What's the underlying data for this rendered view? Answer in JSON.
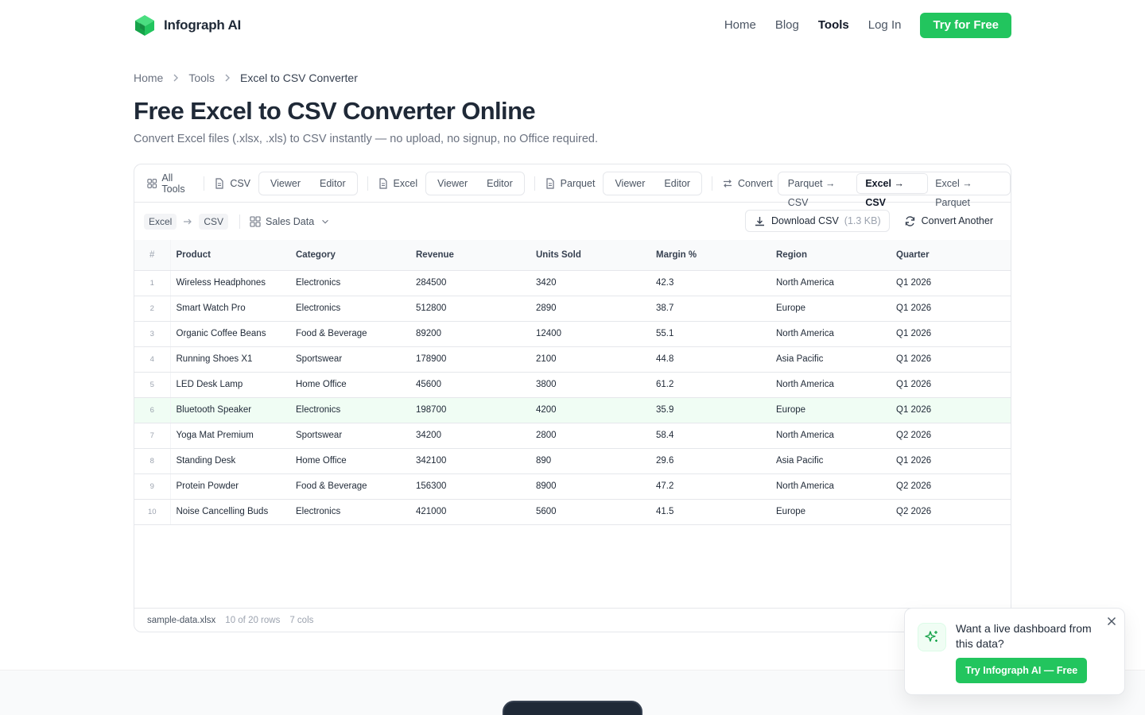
{
  "brand": {
    "name": "Infograph AI",
    "accent": "#22c55e"
  },
  "nav": {
    "links": [
      "Home",
      "Blog",
      "Tools",
      "Log In"
    ],
    "active": "Tools",
    "cta": "Try for Free"
  },
  "breadcrumb": [
    "Home",
    "Tools",
    "Excel to CSV Converter"
  ],
  "page": {
    "title": "Free Excel to CSV Converter Online",
    "subtitle": "Convert Excel files (.xlsx, .xls) to CSV instantly — no upload, no signup, no Office required."
  },
  "toolbar": {
    "all_tools": "All Tools",
    "csv": {
      "label": "CSV",
      "viewer": "Viewer",
      "editor": "Editor"
    },
    "excel": {
      "label": "Excel",
      "viewer": "Viewer",
      "editor": "Editor"
    },
    "parquet": {
      "label": "Parquet",
      "viewer": "Viewer",
      "editor": "Editor"
    },
    "convert": {
      "label": "Convert",
      "options": [
        "Parquet → CSV",
        "Excel → CSV",
        "Excel → Parquet"
      ],
      "active": "Excel → CSV"
    }
  },
  "subbar": {
    "from": "Excel",
    "to": "CSV",
    "sheet": "Sales Data",
    "download_label": "Download CSV",
    "download_size": "(1.3 KB)",
    "convert_another": "Convert Another"
  },
  "table": {
    "row_num_header": "#",
    "headers": [
      "Product",
      "Category",
      "Revenue",
      "Units Sold",
      "Margin %",
      "Region",
      "Quarter"
    ],
    "highlighted_row": 6,
    "rows": [
      [
        "1",
        "Wireless Headphones",
        "Electronics",
        "284500",
        "3420",
        "42.3",
        "North America",
        "Q1 2026"
      ],
      [
        "2",
        "Smart Watch Pro",
        "Electronics",
        "512800",
        "2890",
        "38.7",
        "Europe",
        "Q1 2026"
      ],
      [
        "3",
        "Organic Coffee Beans",
        "Food & Beverage",
        "89200",
        "12400",
        "55.1",
        "North America",
        "Q1 2026"
      ],
      [
        "4",
        "Running Shoes X1",
        "Sportswear",
        "178900",
        "2100",
        "44.8",
        "Asia Pacific",
        "Q1 2026"
      ],
      [
        "5",
        "LED Desk Lamp",
        "Home Office",
        "45600",
        "3800",
        "61.2",
        "North America",
        "Q1 2026"
      ],
      [
        "6",
        "Bluetooth Speaker",
        "Electronics",
        "198700",
        "4200",
        "35.9",
        "Europe",
        "Q1 2026"
      ],
      [
        "7",
        "Yoga Mat Premium",
        "Sportswear",
        "34200",
        "2800",
        "58.4",
        "North America",
        "Q2 2026"
      ],
      [
        "8",
        "Standing Desk",
        "Home Office",
        "342100",
        "890",
        "29.6",
        "Asia Pacific",
        "Q1 2026"
      ],
      [
        "9",
        "Protein Powder",
        "Food & Beverage",
        "156300",
        "8900",
        "47.2",
        "North America",
        "Q2 2026"
      ],
      [
        "10",
        "Noise Cancelling Buds",
        "Electronics",
        "421000",
        "5600",
        "41.5",
        "Europe",
        "Q2 2026"
      ]
    ]
  },
  "footer": {
    "file": "sample-data.xlsx",
    "rows": "10 of 20 rows",
    "cols": "7 cols"
  },
  "popup": {
    "text": "Want a live dashboard from this data?",
    "cta": "Try Infograph AI — Free"
  }
}
